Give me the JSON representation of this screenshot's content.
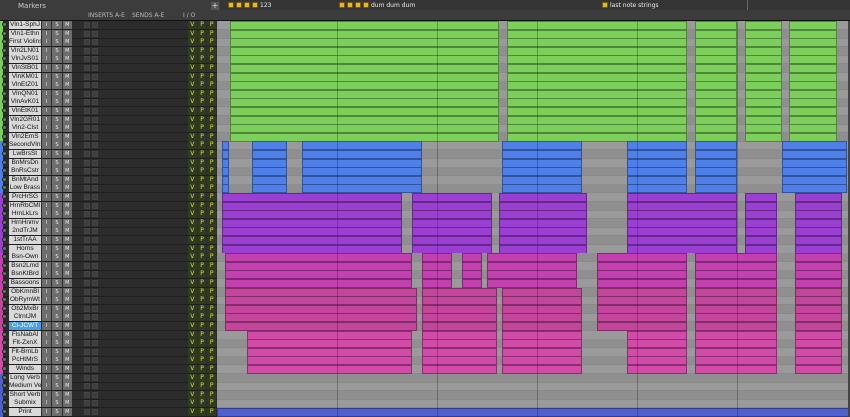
{
  "header": {
    "markers_label": "Markers",
    "inserts_label": "INSERTS A-E",
    "sends_label": "SENDS A-E",
    "io_label": "I / O",
    "add_button": "+"
  },
  "markers": [
    {
      "label": "123",
      "dots": 4
    },
    {
      "label": "dum dum dum",
      "dots": 4
    },
    {
      "label": "last note strings",
      "dots": 1
    }
  ],
  "colors": {
    "strings": "#7ccf5a",
    "second": "#4f7fe8",
    "brass": "#9a3fd1",
    "horns": "#c43fb0",
    "bassoons": "#c4469c",
    "winds": "#d24ba8",
    "verb": "#4f5fd0"
  },
  "tracks": [
    {
      "name": "Vln1-SphJ",
      "group": "strings"
    },
    {
      "name": "Vln1-Ethn",
      "group": "strings"
    },
    {
      "name": "First Violins",
      "group": "strings"
    },
    {
      "name": "Vln2LN01",
      "group": "strings"
    },
    {
      "name": "VlnJvS01",
      "group": "strings"
    },
    {
      "name": "VlnStB01",
      "group": "strings"
    },
    {
      "name": "VlnKM01",
      "group": "strings"
    },
    {
      "name": "VlnEtZ01",
      "group": "strings"
    },
    {
      "name": "VlnQN01",
      "group": "strings"
    },
    {
      "name": "VlnAvK01",
      "group": "strings"
    },
    {
      "name": "VlnEtK01",
      "group": "strings"
    },
    {
      "name": "Vln2GR01",
      "group": "strings"
    },
    {
      "name": "Vln2-Clst",
      "group": "strings"
    },
    {
      "name": "Vln2EmS",
      "group": "strings"
    },
    {
      "name": "SecondVlns",
      "group": "second"
    },
    {
      "name": "LwBrsSt",
      "group": "second"
    },
    {
      "name": "BnMrsDn",
      "group": "second"
    },
    {
      "name": "BnRsCstr",
      "group": "second"
    },
    {
      "name": "BnMtAnd",
      "group": "second"
    },
    {
      "name": "Low Brass",
      "group": "second"
    },
    {
      "name": "PrcHrSG",
      "group": "brass"
    },
    {
      "name": "HrnRbCMl",
      "group": "brass"
    },
    {
      "name": "HrnLkLrs",
      "group": "brass"
    },
    {
      "name": "HrnHnmv",
      "group": "brass"
    },
    {
      "name": "2ndTrJM",
      "group": "brass"
    },
    {
      "name": "1stTrAA",
      "group": "brass"
    },
    {
      "name": "Horns",
      "group": "brass"
    },
    {
      "name": "Bsn-Own",
      "group": "horns"
    },
    {
      "name": "Bsn2Lmd",
      "group": "horns"
    },
    {
      "name": "BsnKtBrd",
      "group": "horns"
    },
    {
      "name": "Bassoons",
      "group": "horns"
    },
    {
      "name": "ObKmnBl",
      "group": "bassoons"
    },
    {
      "name": "ObRymWt",
      "group": "bassoons"
    },
    {
      "name": "Ob2MxBr",
      "group": "bassoons"
    },
    {
      "name": "ClrntJM",
      "group": "bassoons"
    },
    {
      "name": "Cl-JCWT",
      "group": "bassoons",
      "highlight": true
    },
    {
      "name": "FlsNabAl",
      "group": "winds"
    },
    {
      "name": "Flt-ZxnX",
      "group": "winds"
    },
    {
      "name": "Flt-BrnLb",
      "group": "winds"
    },
    {
      "name": "PcHtMrS",
      "group": "winds"
    },
    {
      "name": "Winds",
      "group": "winds"
    },
    {
      "name": "Long Verb",
      "group": "verb"
    },
    {
      "name": "Medium Verb",
      "group": "verb"
    },
    {
      "name": "Short Verb",
      "group": "verb"
    },
    {
      "name": "Submix",
      "group": "verb"
    },
    {
      "name": "Print",
      "group": "verb"
    }
  ],
  "track_buttons": [
    "I",
    "S",
    "M"
  ],
  "io_buttons": [
    "V",
    "P",
    "P"
  ]
}
